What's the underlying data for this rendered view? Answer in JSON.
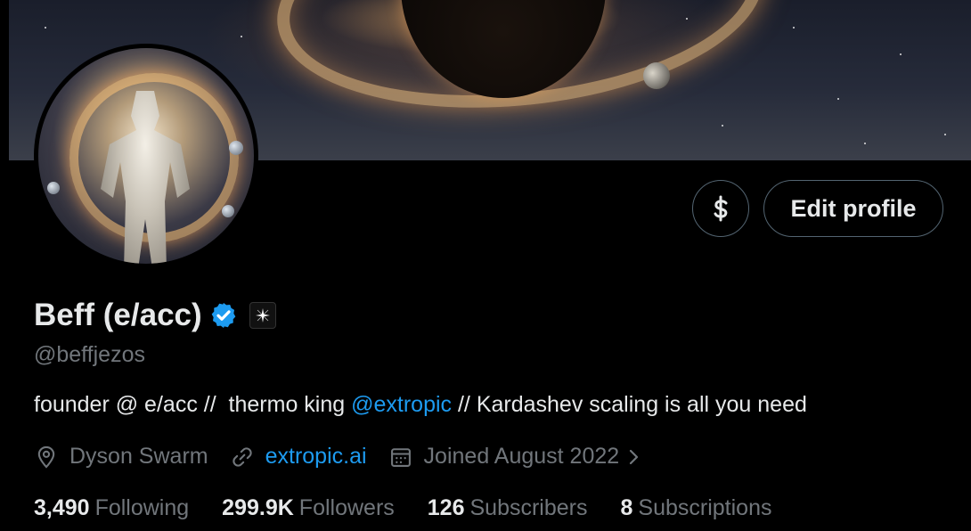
{
  "profile": {
    "display_name": "Beff (e/acc)",
    "handle": "@beffjezos",
    "verified_badge_icon": "verified-badge-icon",
    "affiliation_icon": "affiliation-logo-icon",
    "bio_prefix": "founder @ e/acc //  thermo king ",
    "bio_mention": "@extropic",
    "bio_suffix": " // Kardashev scaling is all you need",
    "location": "Dyson Swarm",
    "website": "extropic.ai",
    "joined": "Joined August 2022"
  },
  "actions": {
    "subscribe_icon": "dollar-icon",
    "edit_profile_label": "Edit profile"
  },
  "stats": [
    {
      "count": "3,490",
      "label": "Following"
    },
    {
      "count": "299.9K",
      "label": "Followers"
    },
    {
      "count": "126",
      "label": "Subscribers"
    },
    {
      "count": "8",
      "label": "Subscriptions"
    }
  ],
  "colors": {
    "background": "#000000",
    "text": "#e7e9ea",
    "secondary_text": "#71767b",
    "link": "#1d9bf0",
    "border": "#536471"
  }
}
